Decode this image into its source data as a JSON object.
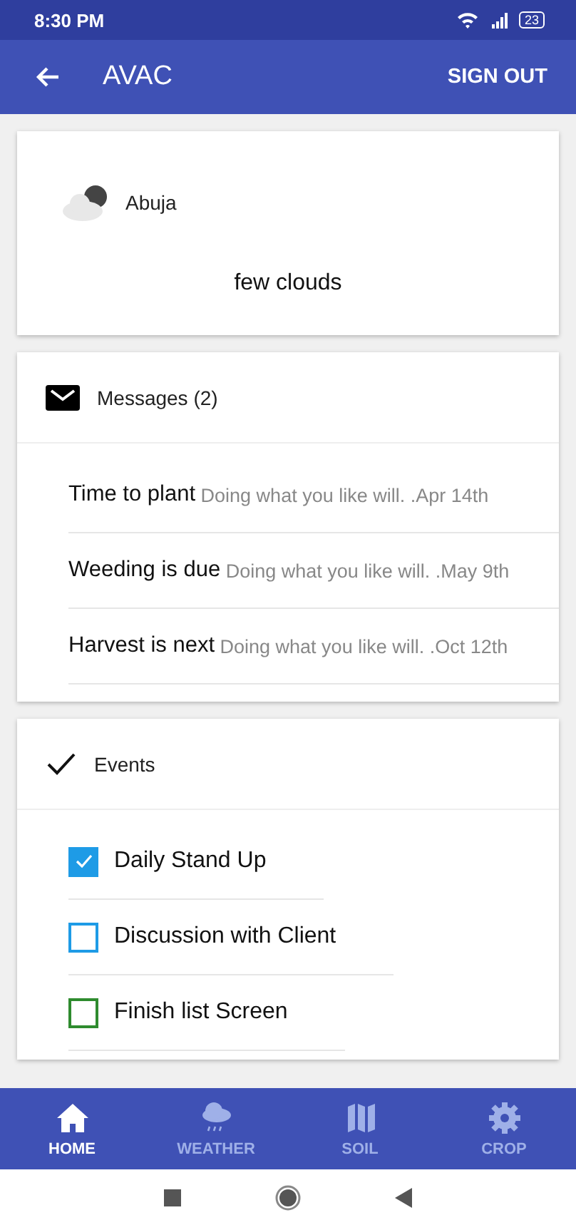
{
  "status_bar": {
    "time": "8:30 PM",
    "battery": "23"
  },
  "app_bar": {
    "title": "AVAC",
    "action": "SIGN OUT"
  },
  "weather": {
    "city": "Abuja",
    "description": "few clouds"
  },
  "messages": {
    "title": "Messages (2)",
    "items": [
      {
        "title": "Time to plant",
        "body": "Doing what you like will. .Apr 14th"
      },
      {
        "title": "Weeding is due",
        "body": "Doing what you like will. .May 9th"
      },
      {
        "title": "Harvest is next",
        "body": "Doing what you like will. .Oct 12th"
      }
    ]
  },
  "events": {
    "title": "Events",
    "items": [
      {
        "label": "Daily Stand Up",
        "checked": true,
        "color": "#1e9be6"
      },
      {
        "label": "Discussion with Client",
        "checked": false,
        "color": "#1e9be6"
      },
      {
        "label": "Finish list Screen",
        "checked": false,
        "color": "#2e8b2e"
      }
    ]
  },
  "bottom_nav": [
    {
      "label": "HOME",
      "selected": true
    },
    {
      "label": "WEATHER",
      "selected": false
    },
    {
      "label": "SOIL",
      "selected": false
    },
    {
      "label": "CROP",
      "selected": false
    }
  ]
}
